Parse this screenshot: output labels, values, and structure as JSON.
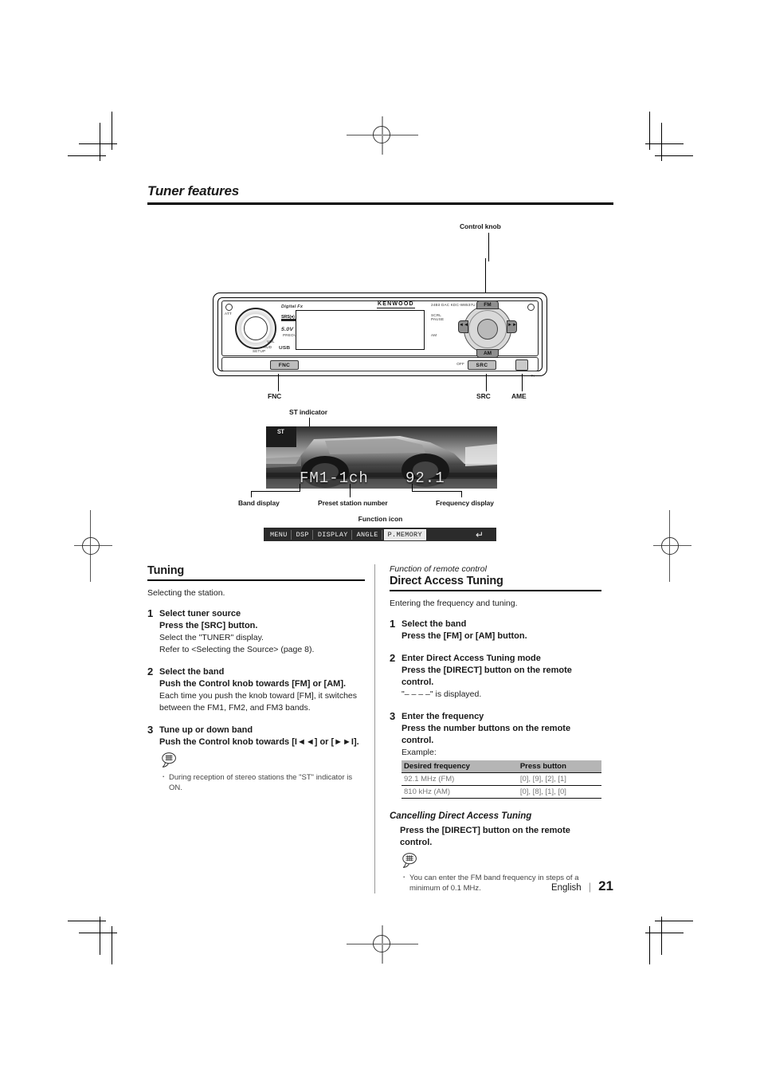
{
  "page": {
    "title": "Tuner features",
    "language": "English",
    "number": "21"
  },
  "diagram": {
    "callouts": {
      "control_knob": "Control knob",
      "fnc": "FNC",
      "src": "SRC",
      "ame": "AME"
    },
    "faceplate": {
      "brand": "KENWOOD",
      "digital_fx": "Digital Fx",
      "srs_label": "SRS(●)",
      "power_label": "5.0V",
      "power_sub": "PREOUT",
      "vol_label": "VOL",
      "aud_label": "AUD",
      "setup_label": "SETUP",
      "usb_label": "USB",
      "att_label": "ATT",
      "model_text": "24Bit DAC  KDC-W8537U",
      "scrl_label": "SCRL",
      "pause_label": "PAUSE",
      "am_label_small": "AM",
      "off_label": "OFF",
      "ti_label": "TI",
      "buttons": {
        "fnc": "FNC",
        "src": "SRC",
        "pad_up": "FM",
        "pad_down": "AM",
        "pad_left": "◄◄",
        "pad_right": "►►"
      }
    }
  },
  "display": {
    "st_indicator_label": "ST indicator",
    "st_indicator_text": "ST",
    "band_text": "FM1-1ch",
    "frequency_text": "92.1",
    "labels": {
      "band": "Band display",
      "preset": "Preset station number",
      "frequency": "Frequency display"
    }
  },
  "function_icon": {
    "title": "Function icon",
    "items": [
      {
        "label": "MENU",
        "selected": false
      },
      {
        "label": "DSP",
        "selected": false
      },
      {
        "label": "DISPLAY",
        "selected": false
      },
      {
        "label": "ANGLE",
        "selected": false
      },
      {
        "label": "P.MEMORY",
        "selected": true
      }
    ],
    "return_glyph": "↵"
  },
  "tuning": {
    "heading": "Tuning",
    "lede": "Selecting the station.",
    "steps": [
      {
        "num": "1",
        "title": "Select tuner source",
        "bold": "Press the [SRC] button.",
        "notes": [
          "Select the \"TUNER\" display.",
          "Refer to <Selecting the Source> (page 8)."
        ]
      },
      {
        "num": "2",
        "title": "Select the band",
        "bold": "Push the Control knob towards [FM] or [AM].",
        "notes": [
          "Each time you push the knob toward [FM], it switches between the FM1, FM2, and FM3 bands."
        ]
      },
      {
        "num": "3",
        "title": "Tune up or down band",
        "bold": "Push the Control knob towards [I◄◄] or [►►I].",
        "notes": []
      }
    ],
    "note_bullet": "During reception of stereo stations the \"ST\" indicator is ON."
  },
  "direct_access": {
    "kicker": "Function of remote control",
    "heading": "Direct Access Tuning",
    "lede": "Entering the frequency and tuning.",
    "steps": [
      {
        "num": "1",
        "title": "Select the band",
        "bold": "Press the [FM] or [AM] button.",
        "notes": []
      },
      {
        "num": "2",
        "title": "Enter Direct Access Tuning mode",
        "bold": "Press the [DIRECT] button on the remote control.",
        "notes": [
          "\"– – – –\" is displayed."
        ]
      },
      {
        "num": "3",
        "title": "Enter the frequency",
        "bold": "Press the number buttons on the remote control.",
        "notes": [
          "Example:"
        ]
      }
    ],
    "table": {
      "headers": [
        "Desired frequency",
        "Press button"
      ],
      "rows": [
        [
          "92.1 MHz (FM)",
          "[0], [9], [2], [1]"
        ],
        [
          "810 kHz (AM)",
          "[0], [8], [1], [0]"
        ]
      ]
    },
    "cancel": {
      "heading": "Cancelling Direct Access Tuning",
      "body": "Press the [DIRECT] button on the remote control.",
      "note_bullet": "You can enter the FM band frequency in steps of a minimum of 0.1 MHz."
    }
  }
}
